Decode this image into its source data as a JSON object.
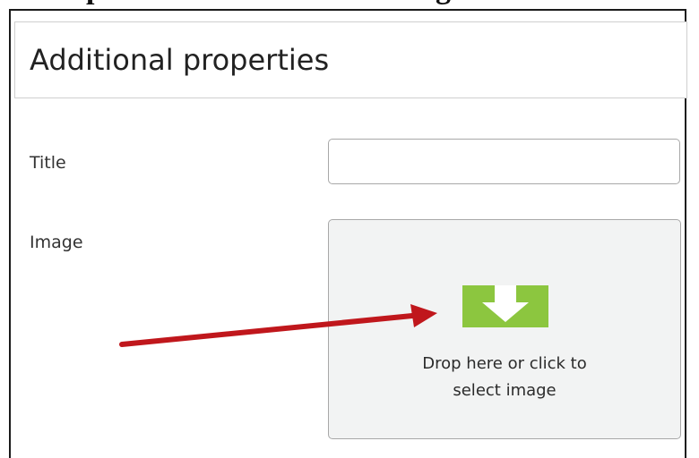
{
  "page_fragment": {
    "left_text": "p",
    "right_text": "g"
  },
  "panel": {
    "title": "Additional properties"
  },
  "form": {
    "title_label": "Title",
    "title_value": "",
    "image_label": "Image"
  },
  "drop_zone": {
    "line1": "Drop here or click to",
    "line2": "select image",
    "icon": "download-arrow-icon",
    "icon_color": "#8cc63f"
  },
  "annotation": {
    "arrow_color": "#c0171c"
  }
}
